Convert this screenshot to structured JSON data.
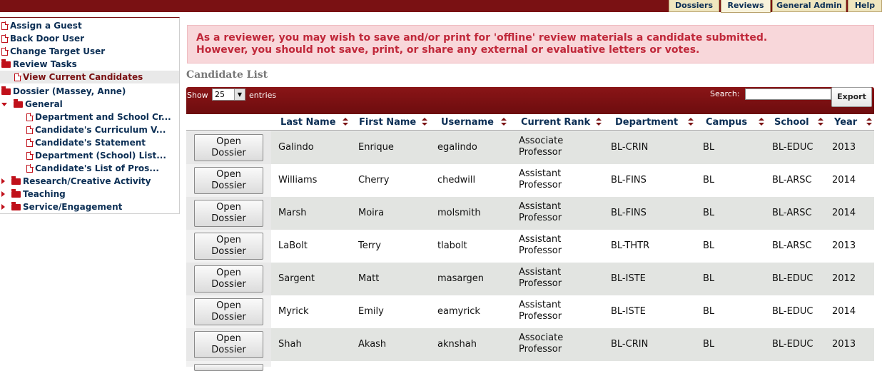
{
  "top_tabs": [
    {
      "label": "Dossiers"
    },
    {
      "label": "Reviews"
    },
    {
      "label": "General Admin"
    },
    {
      "label": "Help"
    }
  ],
  "sidebar": {
    "items": [
      {
        "label": "Assign a Guest"
      },
      {
        "label": "Back Door User"
      },
      {
        "label": "Change Target User"
      },
      {
        "label": "Review Tasks"
      },
      {
        "label": "View Current Candidates"
      },
      {
        "label": "Dossier (Massey, Anne)"
      },
      {
        "label": "General"
      },
      {
        "label": "Department and School Cr..."
      },
      {
        "label": "Candidate's Curriculum V..."
      },
      {
        "label": "Candidate's Statement"
      },
      {
        "label": "Department (School) List..."
      },
      {
        "label": "Candidate's List of Pros..."
      },
      {
        "label": "Research/Creative Activity"
      },
      {
        "label": "Teaching"
      },
      {
        "label": "Service/Engagement"
      }
    ]
  },
  "alert": {
    "line1": "As a reviewer, you may wish to save and/or print for 'offline' review materials a candidate submitted.",
    "line2": "However, you should not save, print, or share any external or evaluative letters or votes."
  },
  "section_title": "Candidate List",
  "toolbar": {
    "show_label": "Show",
    "entries_value": "25",
    "entries_label": "entries",
    "search_label": "Search:",
    "search_value": "",
    "export_label": "Export"
  },
  "table": {
    "columns": [
      "Last Name",
      "First Name",
      "Username",
      "Current Rank",
      "Department",
      "Campus",
      "School",
      "Year"
    ],
    "open_button_line1": "Open",
    "open_button_line2": "Dossier",
    "rows": [
      {
        "last": "Galindo",
        "first": "Enrique",
        "username": "egalindo",
        "rank1": "Associate",
        "rank2": "Professor",
        "dept": "BL-CRIN",
        "campus": "BL",
        "school": "BL-EDUC",
        "year": "2013"
      },
      {
        "last": "Williams",
        "first": "Cherry",
        "username": "chedwill",
        "rank1": "Assistant",
        "rank2": "Professor",
        "dept": "BL-FINS",
        "campus": "BL",
        "school": "BL-ARSC",
        "year": "2014"
      },
      {
        "last": "Marsh",
        "first": "Moira",
        "username": "molsmith",
        "rank1": "Assistant",
        "rank2": "Professor",
        "dept": "BL-FINS",
        "campus": "BL",
        "school": "BL-ARSC",
        "year": "2014"
      },
      {
        "last": "LaBolt",
        "first": "Terry",
        "username": "tlabolt",
        "rank1": "Assistant",
        "rank2": "Professor",
        "dept": "BL-THTR",
        "campus": "BL",
        "school": "BL-ARSC",
        "year": "2013"
      },
      {
        "last": "Sargent",
        "first": "Matt",
        "username": "masargen",
        "rank1": "Assistant",
        "rank2": "Professor",
        "dept": "BL-ISTE",
        "campus": "BL",
        "school": "BL-EDUC",
        "year": "2012"
      },
      {
        "last": "Myrick",
        "first": "Emily",
        "username": "eamyrick",
        "rank1": "Assistant",
        "rank2": "Professor",
        "dept": "BL-ISTE",
        "campus": "BL",
        "school": "BL-EDUC",
        "year": "2014"
      },
      {
        "last": "Shah",
        "first": "Akash",
        "username": "aknshah",
        "rank1": "Associate",
        "rank2": "Professor",
        "dept": "BL-CRIN",
        "campus": "BL",
        "school": "BL-EDUC",
        "year": "2013"
      }
    ]
  }
}
